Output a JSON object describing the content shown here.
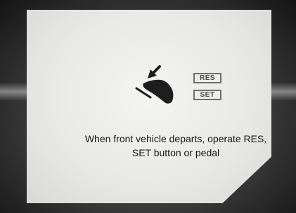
{
  "display": {
    "buttons": {
      "res_label": "RES",
      "set_label": "SET"
    },
    "message": "When front vehicle departs, operate RES, SET button or pedal",
    "icons": {
      "pedal": "foot-pressing-pedal-icon",
      "arrow": "down-left-arrow-icon"
    },
    "colors": {
      "screen_bg": "#ebebe9",
      "text": "#151515",
      "icon": "#1e1e1e",
      "bezel": "#2a2a2a"
    }
  }
}
